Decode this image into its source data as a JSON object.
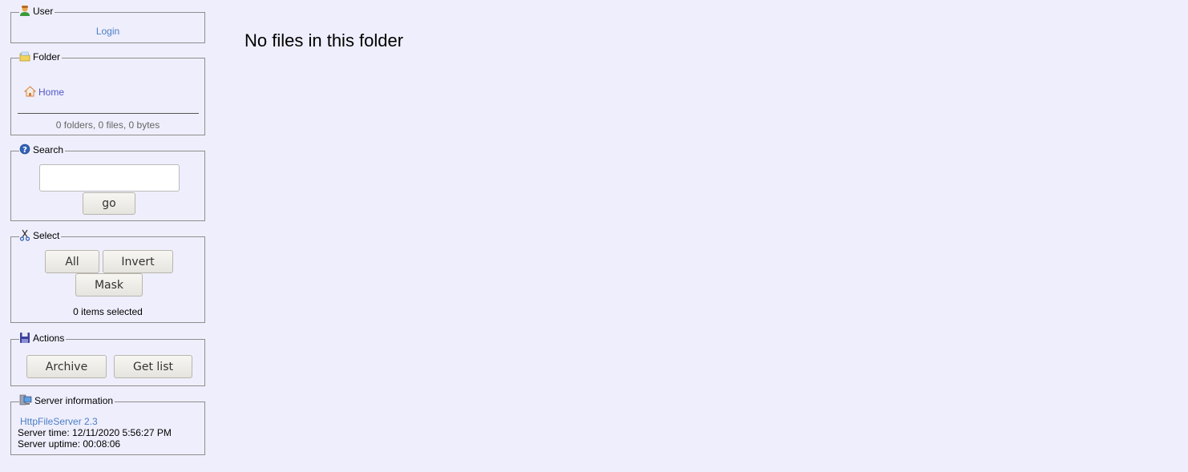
{
  "user": {
    "title": "User",
    "login": "Login"
  },
  "folder": {
    "title": "Folder",
    "home": "Home",
    "stats": "0 folders, 0 files, 0 bytes"
  },
  "search": {
    "title": "Search",
    "placeholder": "",
    "go": "go"
  },
  "select": {
    "title": "Select",
    "all": "All",
    "invert": "Invert",
    "mask": "Mask",
    "count": "0 items selected"
  },
  "actions": {
    "title": "Actions",
    "archive": "Archive",
    "get_list": "Get list"
  },
  "server": {
    "title": "Server information",
    "link": "HttpFileServer 2.3",
    "time": "Server time: 12/11/2020 5:56:27 PM",
    "uptime": "Server uptime: 00:08:06"
  },
  "main": {
    "empty_message": "No files in this folder"
  },
  "icons": [
    "user-icon",
    "folder-icon",
    "home-icon",
    "help-icon",
    "scissors-icon",
    "floppy-icon",
    "server-icon"
  ]
}
